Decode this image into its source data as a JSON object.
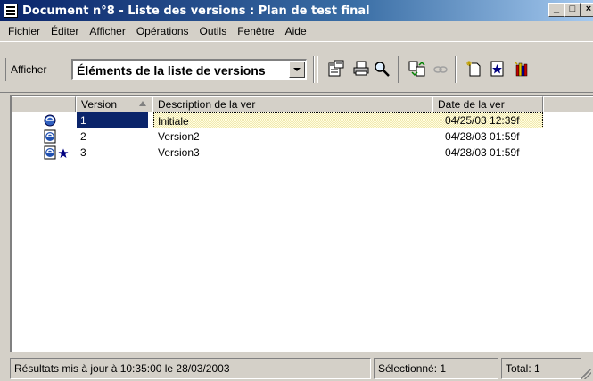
{
  "window": {
    "title": "Document n°8 - Liste des versions : Plan de test final",
    "min_label": "_",
    "max_label": "□",
    "close_label": "×"
  },
  "menu": [
    "Fichier",
    "Éditer",
    "Afficher",
    "Opérations",
    "Outils",
    "Fenêtre",
    "Aide"
  ],
  "toolbar": {
    "show_label": "Afficher",
    "view_select_value": "Éléments de la liste de versions",
    "icons": [
      "properties-icon",
      "print-icon",
      "find-icon",
      "compare-icon",
      "link-icon",
      "new-version-icon",
      "star-icon",
      "library-icon"
    ]
  },
  "list": {
    "columns": [
      "Version",
      "Description de la ver",
      "Date de la ver"
    ],
    "rows": [
      {
        "version": "1",
        "description": "Initiale",
        "date": "04/25/03 12:39f"
      },
      {
        "version": "2",
        "description": "Version2",
        "date": "04/28/03 01:59f"
      },
      {
        "version": "3",
        "description": "Version3",
        "date": "04/28/03 01:59f"
      }
    ]
  },
  "status": {
    "updated": "Résultats mis à jour à 10:35:00 le 28/03/2003",
    "selected": "Sélectionné: 1",
    "total": "Total: 1"
  },
  "colors": {
    "titlebar_start": "#0a246a",
    "titlebar_end": "#a6caf0",
    "selection": "#0a246a",
    "face": "#d4d0c8"
  }
}
